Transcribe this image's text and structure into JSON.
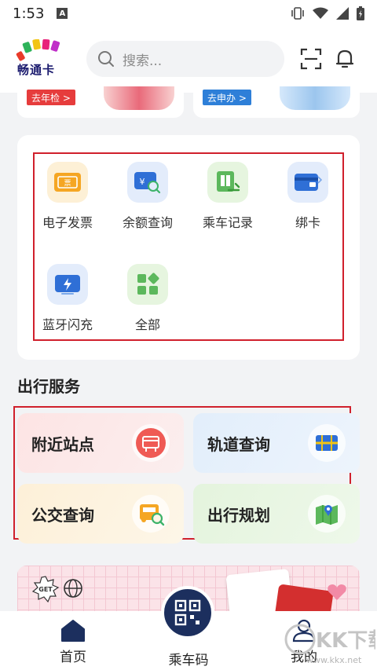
{
  "status_bar": {
    "time": "1:53",
    "a_badge": "A"
  },
  "header": {
    "logo_text": "畅通卡",
    "search_placeholder": "搜索..."
  },
  "top_cards": [
    {
      "tag": "去年检 >"
    },
    {
      "tag": "去申办 >"
    }
  ],
  "functions": [
    {
      "label": "电子发票",
      "icon": "invoice-icon"
    },
    {
      "label": "余额查询",
      "icon": "balance-query-icon"
    },
    {
      "label": "乘车记录",
      "icon": "ride-record-icon"
    },
    {
      "label": "绑卡",
      "icon": "bind-card-icon"
    },
    {
      "label": "蓝牙闪充",
      "icon": "bluetooth-charge-icon"
    },
    {
      "label": "全部",
      "icon": "all-grid-icon"
    }
  ],
  "travel_section": {
    "title": "出行服务",
    "tiles": [
      {
        "label": "附近站点",
        "icon": "bus-stop-icon"
      },
      {
        "label": "轨道查询",
        "icon": "metro-icon"
      },
      {
        "label": "公交查询",
        "icon": "bus-search-icon"
      },
      {
        "label": "出行规划",
        "icon": "map-pin-icon"
      }
    ]
  },
  "bottom_nav": {
    "home": "首页",
    "ride_code": "乘车码",
    "mine": "我的"
  },
  "watermark": {
    "text": "KK下载",
    "url_text": "www.kkx.net"
  },
  "colors": {
    "accent_red": "#d0202c",
    "navy": "#1c2f5e"
  }
}
